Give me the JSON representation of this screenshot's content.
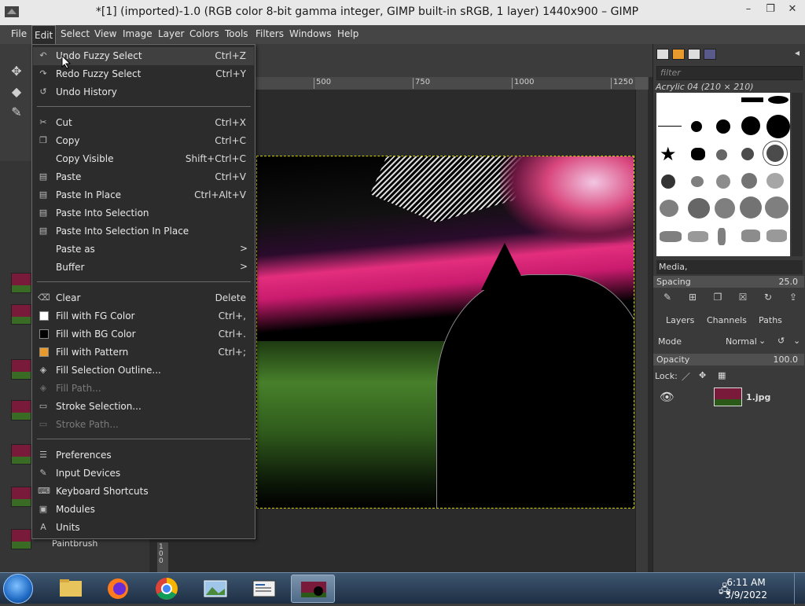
{
  "window": {
    "title": "*[1] (imported)-1.0 (RGB color 8-bit gamma integer, GIMP built-in sRGB, 1 layer) 1440x900 – GIMP"
  },
  "menubar": [
    "File",
    "Edit",
    "Select",
    "View",
    "Image",
    "Layer",
    "Colors",
    "Tools",
    "Filters",
    "Windows",
    "Help"
  ],
  "edit_menu": {
    "items": [
      {
        "label": "Undo Fuzzy Select",
        "shortcut": "Ctrl+Z",
        "icon": "undo-icon"
      },
      {
        "label": "Redo Fuzzy Select",
        "shortcut": "Ctrl+Y",
        "icon": "redo-icon"
      },
      {
        "label": "Undo History",
        "shortcut": "",
        "icon": "undo-history-icon"
      },
      {
        "label": "Cut",
        "shortcut": "Ctrl+X",
        "icon": "cut-icon"
      },
      {
        "label": "Copy",
        "shortcut": "Ctrl+C",
        "icon": "copy-icon"
      },
      {
        "label": "Copy Visible",
        "shortcut": "Shift+Ctrl+C",
        "icon": ""
      },
      {
        "label": "Paste",
        "shortcut": "Ctrl+V",
        "icon": "paste-icon"
      },
      {
        "label": "Paste In Place",
        "shortcut": "Ctrl+Alt+V",
        "icon": "paste-in-place-icon"
      },
      {
        "label": "Paste Into Selection",
        "shortcut": "",
        "icon": "paste-into-selection-icon"
      },
      {
        "label": "Paste Into Selection In Place",
        "shortcut": "",
        "icon": "paste-into-selection-in-place-icon"
      },
      {
        "label": "Paste as",
        "shortcut": "",
        "icon": ""
      },
      {
        "label": "Buffer",
        "shortcut": "",
        "icon": ""
      },
      {
        "label": "Clear",
        "shortcut": "Delete",
        "icon": "clear-icon"
      },
      {
        "label": "Fill with FG Color",
        "shortcut": "Ctrl+,",
        "icon": "fg-color-swatch"
      },
      {
        "label": "Fill with BG Color",
        "shortcut": "Ctrl+.",
        "icon": "bg-color-swatch"
      },
      {
        "label": "Fill with Pattern",
        "shortcut": "Ctrl+;",
        "icon": "pattern-swatch"
      },
      {
        "label": "Fill Selection Outline...",
        "shortcut": "",
        "icon": "fill-outline-icon"
      },
      {
        "label": "Fill Path...",
        "shortcut": "",
        "icon": "fill-path-icon"
      },
      {
        "label": "Stroke Selection...",
        "shortcut": "",
        "icon": "stroke-selection-icon"
      },
      {
        "label": "Stroke Path...",
        "shortcut": "",
        "icon": "stroke-path-icon"
      },
      {
        "label": "Preferences",
        "shortcut": "",
        "icon": "preferences-icon"
      },
      {
        "label": "Input Devices",
        "shortcut": "",
        "icon": "input-devices-icon"
      },
      {
        "label": "Keyboard Shortcuts",
        "shortcut": "",
        "icon": "keyboard-icon"
      },
      {
        "label": "Modules",
        "shortcut": "",
        "icon": "modules-icon"
      },
      {
        "label": "Units",
        "shortcut": "",
        "icon": "units-icon"
      }
    ]
  },
  "ruler": {
    "ticks": [
      "500",
      "750",
      "1000",
      "1250"
    ]
  },
  "vruler": {
    "label": "100"
  },
  "tool_options": {
    "brush_label": "Paintbrush"
  },
  "brushes": {
    "filter_placeholder": "filter",
    "selected_brush": "Acrylic 04 (210 × 210)",
    "tag": "Media,",
    "spacing_label": "Spacing",
    "spacing_value": "25.0"
  },
  "layers": {
    "tabs": [
      "Layers",
      "Channels",
      "Paths"
    ],
    "mode_label": "Mode",
    "mode_value": "Normal",
    "opacity_label": "Opacity",
    "opacity_value": "100.0",
    "lock_label": "Lock:",
    "layer_name": "1.jpg"
  },
  "taskbar": {
    "time": "6:11 AM",
    "date": "3/9/2022"
  },
  "colors": {
    "accent": "#e32e7d",
    "menu_bg": "#2c2c2c",
    "fg_swatch": "#ffffff",
    "bg_swatch": "#000000",
    "pattern_swatch": "#e89a2c"
  }
}
